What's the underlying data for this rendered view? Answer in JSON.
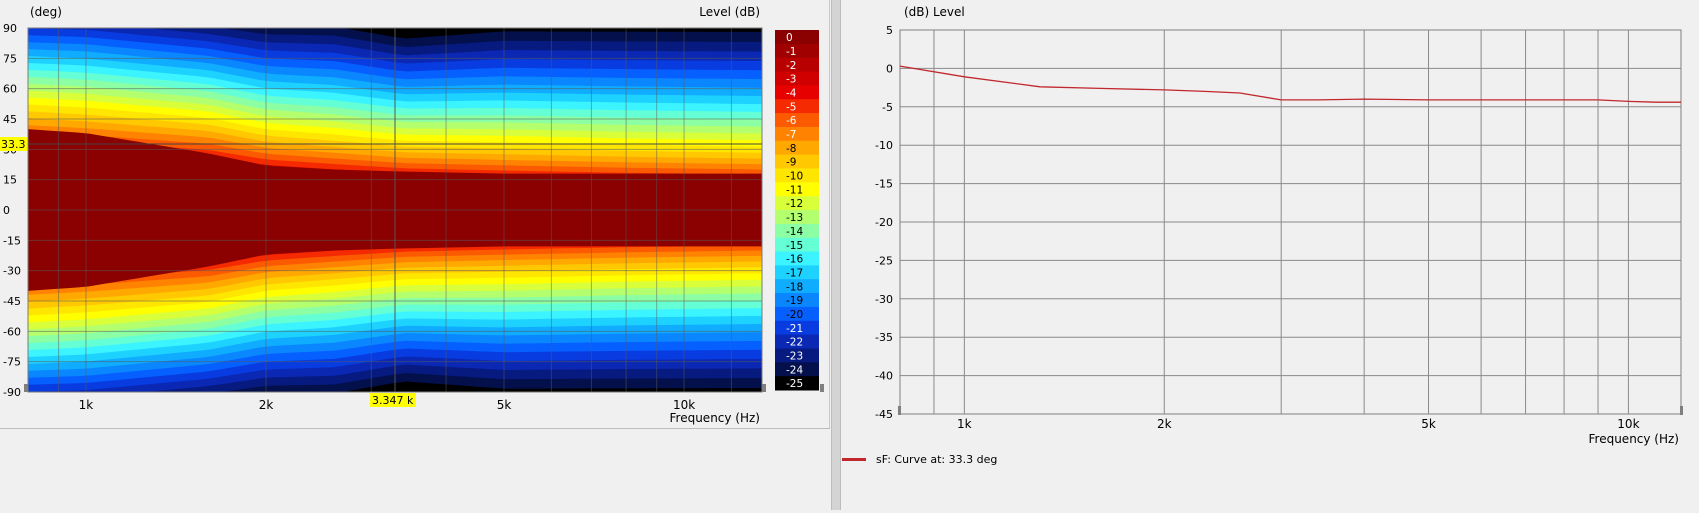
{
  "heatmap": {
    "y_unit_label": "(deg)",
    "level_label": "Level  (dB)",
    "x_axis_label": "Frequency  (Hz)",
    "y_ticks": [
      "90",
      "75",
      "60",
      "45",
      "30",
      "15",
      "0",
      "-15",
      "-30",
      "-45",
      "-60",
      "-75",
      "-90"
    ],
    "x_ticks": [
      "1k",
      "2k",
      "5k",
      "10k"
    ],
    "cursor_y_label": "33.3",
    "cursor_x_label": "3.347 k",
    "colorbar_ticks": [
      "0",
      "-1",
      "-2",
      "-3",
      "-4",
      "-5",
      "-6",
      "-7",
      "-8",
      "-9",
      "-10",
      "-11",
      "-12",
      "-13",
      "-14",
      "-15",
      "-16",
      "-17",
      "-18",
      "-19",
      "-20",
      "-21",
      "-22",
      "-23",
      "-24",
      "-25"
    ],
    "colorbar_colors": [
      "#8b0000",
      "#a00000",
      "#b80000",
      "#d00000",
      "#e60000",
      "#f52a00",
      "#fb5a00",
      "#ff8200",
      "#ffa800",
      "#ffc800",
      "#ffe600",
      "#ffff00",
      "#d8ff3a",
      "#b4ff6e",
      "#8cffa4",
      "#64ffd4",
      "#3cf4ff",
      "#1ed2ff",
      "#10acff",
      "#0a86ff",
      "#0660ff",
      "#083ce0",
      "#0a28b4",
      "#061a80",
      "#03104c",
      "#000000"
    ]
  },
  "chart_data": {
    "type": "line",
    "x_unit_label": "Frequency  (Hz)",
    "y_unit_label": "(dB)  Level",
    "y_ticks": [
      "5",
      "0",
      "-5",
      "-10",
      "-15",
      "-20",
      "-25",
      "-30",
      "-35",
      "-40",
      "-45"
    ],
    "x_ticks": [
      "1k",
      "2k",
      "5k",
      "10k"
    ],
    "ylim": [
      -45,
      5
    ],
    "xlim": [
      800,
      12000
    ],
    "x_scale": "log",
    "grid": true,
    "series": [
      {
        "name": "sF: Curve at: 33.3 deg",
        "color": "#c0282d",
        "x": [
          800,
          1000,
          1300,
          1600,
          2000,
          2300,
          2600,
          3000,
          3400,
          4000,
          5000,
          6000,
          7000,
          8000,
          9000,
          10000,
          11000,
          12000
        ],
        "y": [
          0.3,
          -1.1,
          -2.4,
          -2.6,
          -2.8,
          -3.0,
          -3.2,
          -4.1,
          -4.1,
          -4.0,
          -4.1,
          -4.1,
          -4.1,
          -4.1,
          -4.1,
          -4.3,
          -4.4,
          -4.4
        ]
      }
    ]
  },
  "legend": {
    "label": "sF: Curve at: 33.3 deg",
    "color": "#c0282d"
  }
}
